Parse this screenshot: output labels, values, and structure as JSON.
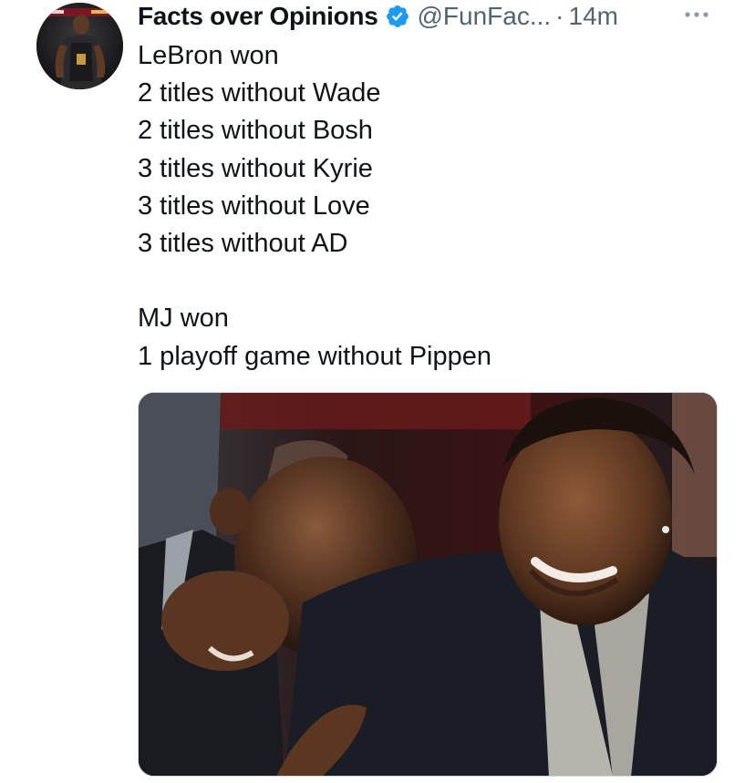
{
  "tweet": {
    "author_name": "Facts over Opinions",
    "handle": "@FunFac...",
    "separator": "·",
    "time": "14m",
    "text_lines": [
      "LeBron won",
      "2 titles without Wade",
      "2 titles without Bosh",
      "3 titles without Kyrie",
      "3 titles without Love",
      "3 titles without AD",
      "",
      "MJ won",
      "1 playoff game without Pippen"
    ]
  },
  "icons": {
    "verified": "verified-badge-icon",
    "more": "more-options-icon"
  },
  "colors": {
    "verified": "#1d9bf0",
    "secondary_text": "#536471",
    "primary_text": "#0f1419"
  }
}
